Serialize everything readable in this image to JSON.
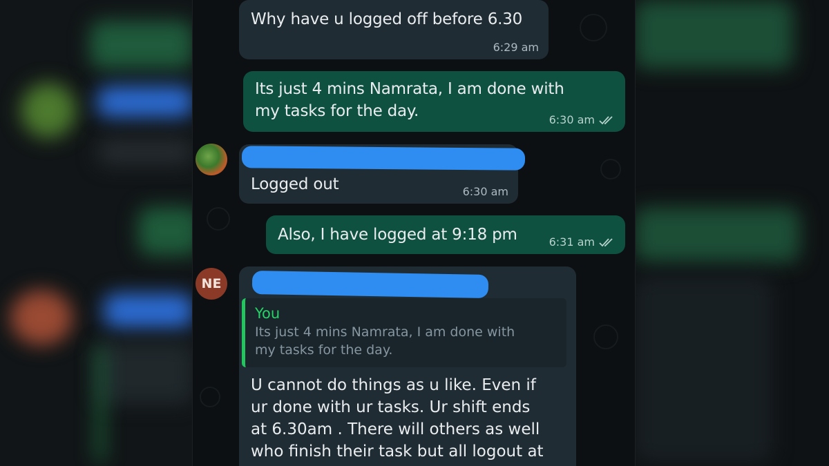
{
  "messages": [
    {
      "direction": "in",
      "text": "Why have u logged off before 6.30",
      "time": "6:29 am"
    },
    {
      "direction": "out",
      "text_line1": "Its just 4 mins Namrata, I am done with",
      "text_line2": "my tasks for the day.",
      "time": "6:30 am",
      "status": "read-double-tick"
    },
    {
      "direction": "in",
      "text": "Logged out",
      "time": "6:30 am",
      "sender_redacted": true
    },
    {
      "direction": "out",
      "text": "Also, I have logged at 9:18 pm",
      "time": "6:31 am",
      "status": "read-double-tick"
    },
    {
      "direction": "in",
      "sender_initials": "NE",
      "sender_redacted": true,
      "quote": {
        "author": "You",
        "line1": "Its just 4 mins Namrata, I am done with",
        "line2": "my tasks for the day."
      },
      "lines": [
        "U cannot do things as u like. Even if",
        "ur done with ur tasks. Ur shift ends",
        "at 6.30am . There will others as well",
        "who finish their task but all logout at"
      ]
    }
  ],
  "colors": {
    "incoming_bubble": "#202c33",
    "outgoing_bubble": "#0f5141",
    "quote_accent": "#22c55e",
    "redaction": "#2f8cf0",
    "ne_avatar": "#8a3a26"
  },
  "icons": {
    "ticks": "double-check-icon"
  }
}
